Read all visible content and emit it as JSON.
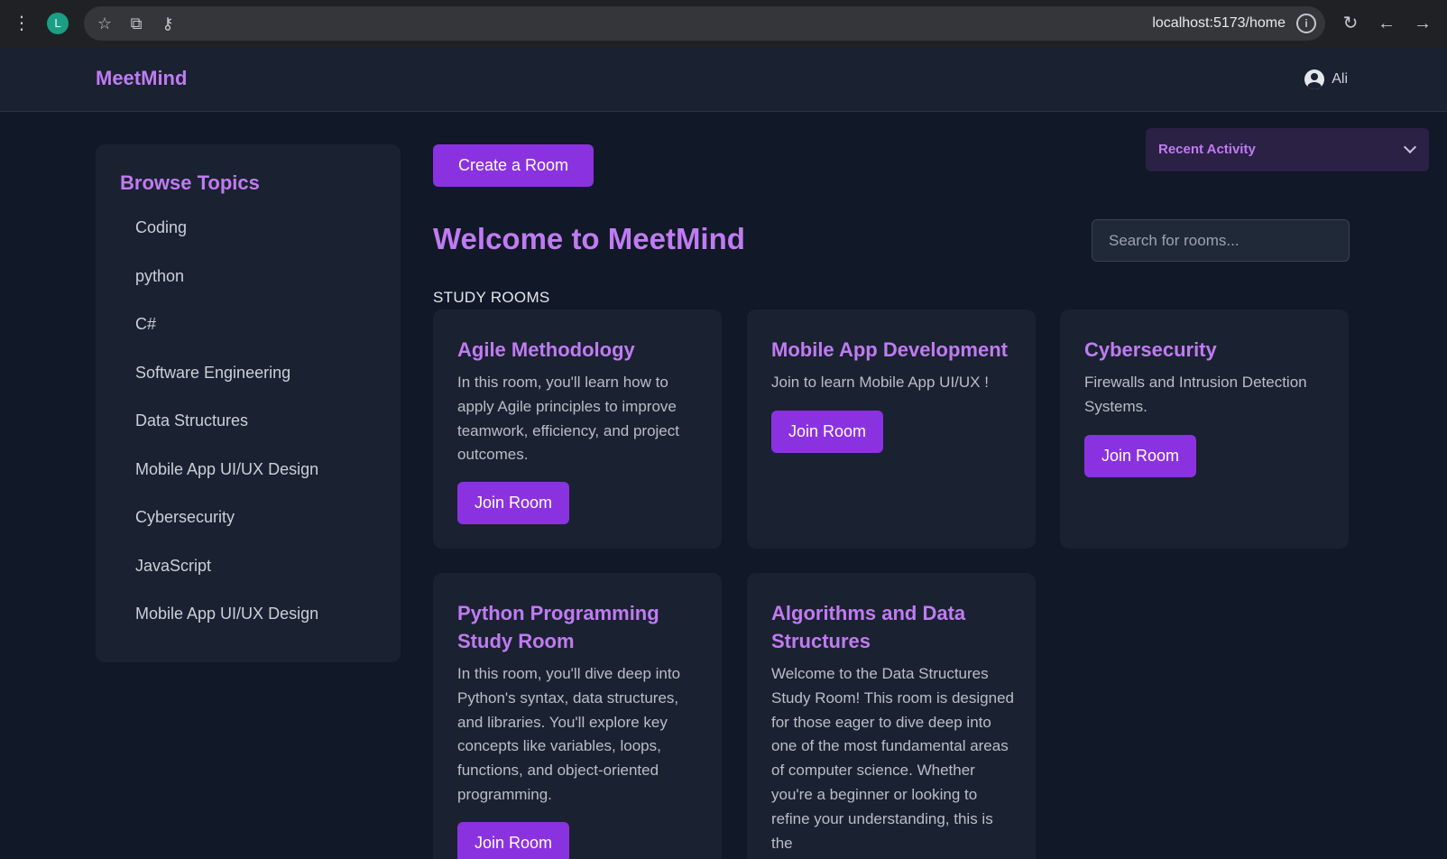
{
  "browser": {
    "avatar_letter": "L",
    "url": "localhost:5173/home"
  },
  "header": {
    "brand": "MeetMind",
    "user_name": "Ali"
  },
  "sidebar": {
    "title": "Browse Topics",
    "topics": [
      "Coding",
      "python",
      "C#",
      "Software Engineering",
      "Data Structures",
      "Mobile App UI/UX Design",
      "Cybersecurity",
      "JavaScript",
      "Mobile App UI/UX Design"
    ]
  },
  "main": {
    "create_label": "Create a Room",
    "welcome": "Welcome to MeetMind",
    "search_placeholder": "Search for rooms...",
    "section_label": "STUDY ROOMS",
    "join_label": "Join Room"
  },
  "activity": {
    "label": "Recent Activity"
  },
  "rooms": [
    {
      "title": "Agile Methodology",
      "description": "In this room, you'll learn how to apply Agile principles to improve teamwork, efficiency, and project outcomes."
    },
    {
      "title": "Mobile App Development",
      "description": "Join to learn Mobile App UI/UX !"
    },
    {
      "title": "Cybersecurity",
      "description": "Firewalls and Intrusion Detection Systems."
    },
    {
      "title": "Python Programming Study Room",
      "description": "In this room, you'll dive deep into Python's syntax, data structures, and libraries. You'll explore key concepts like variables, loops, functions, and object-oriented programming."
    },
    {
      "title": "Algorithms and Data Structures",
      "description": "Welcome to the Data Structures Study Room! This room is designed for those eager to dive deep into one of the most fundamental areas of computer science. Whether you're a beginner or looking to refine your understanding, this is the"
    }
  ]
}
